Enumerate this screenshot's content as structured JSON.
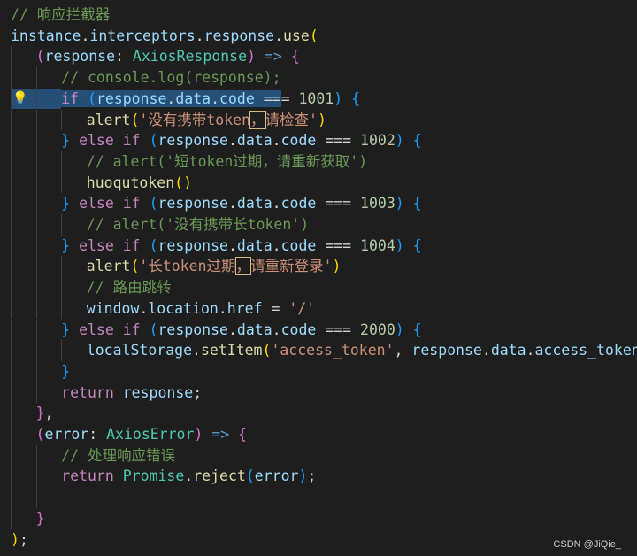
{
  "editor": {
    "lines": [
      {
        "segments": [
          {
            "t": "// 响应拦截器",
            "c": "comment"
          }
        ]
      },
      {
        "segments": [
          {
            "t": "instance",
            "c": "variable"
          },
          {
            "t": ".",
            "c": "plain"
          },
          {
            "t": "interceptors",
            "c": "variable"
          },
          {
            "t": ".",
            "c": "plain"
          },
          {
            "t": "response",
            "c": "variable"
          },
          {
            "t": ".",
            "c": "plain"
          },
          {
            "t": "use",
            "c": "function"
          },
          {
            "t": "(",
            "c": "brace1"
          }
        ]
      },
      {
        "segments": [
          {
            "t": "(",
            "c": "brace2"
          },
          {
            "t": "response",
            "c": "variable"
          },
          {
            "t": ": ",
            "c": "plain"
          },
          {
            "t": "AxiosResponse",
            "c": "type"
          },
          {
            "t": ")",
            "c": "brace2"
          },
          {
            "t": " ",
            "c": "plain"
          },
          {
            "t": "=>",
            "c": "storage"
          },
          {
            "t": " ",
            "c": "plain"
          },
          {
            "t": "{",
            "c": "brace2"
          }
        ]
      },
      {
        "segments": [
          {
            "t": "// console.log(response);",
            "c": "comment"
          }
        ]
      },
      {
        "segments": [
          {
            "t": "if",
            "c": "keyword",
            "sel": true
          },
          {
            "t": " ",
            "c": "plain",
            "sel": true
          },
          {
            "t": "(",
            "c": "brace3",
            "sel": true
          },
          {
            "t": "response",
            "c": "variable",
            "sel": true
          },
          {
            "t": ".",
            "c": "plain",
            "sel": true
          },
          {
            "t": "data",
            "c": "variable",
            "sel": true
          },
          {
            "t": ".",
            "c": "plain",
            "sel": true
          },
          {
            "t": "code",
            "c": "variable",
            "sel": true
          },
          {
            "t": " ==",
            "c": "plain",
            "sel": true
          },
          {
            "t": "=",
            "c": "plain"
          },
          {
            "t": " ",
            "c": "plain"
          },
          {
            "t": "1001",
            "c": "number"
          },
          {
            "t": ")",
            "c": "brace3"
          },
          {
            "t": " ",
            "c": "plain"
          },
          {
            "t": "{",
            "c": "brace3"
          }
        ]
      },
      {
        "segments": [
          {
            "t": "alert",
            "c": "function"
          },
          {
            "t": "(",
            "c": "brace1"
          },
          {
            "t": "'没有携带token",
            "c": "string"
          },
          {
            "t": "，",
            "c": "string",
            "box": true
          },
          {
            "t": "请检查'",
            "c": "string"
          },
          {
            "t": ")",
            "c": "brace1"
          }
        ]
      },
      {
        "segments": [
          {
            "t": "}",
            "c": "brace3"
          },
          {
            "t": " ",
            "c": "plain"
          },
          {
            "t": "else",
            "c": "keyword"
          },
          {
            "t": " ",
            "c": "plain"
          },
          {
            "t": "if",
            "c": "keyword"
          },
          {
            "t": " ",
            "c": "plain"
          },
          {
            "t": "(",
            "c": "brace3"
          },
          {
            "t": "response",
            "c": "variable"
          },
          {
            "t": ".",
            "c": "plain"
          },
          {
            "t": "data",
            "c": "variable"
          },
          {
            "t": ".",
            "c": "plain"
          },
          {
            "t": "code",
            "c": "variable"
          },
          {
            "t": " === ",
            "c": "plain"
          },
          {
            "t": "1002",
            "c": "number"
          },
          {
            "t": ")",
            "c": "brace3"
          },
          {
            "t": " ",
            "c": "plain"
          },
          {
            "t": "{",
            "c": "brace3"
          }
        ]
      },
      {
        "segments": [
          {
            "t": "// alert('短token过期，请重新获取')",
            "c": "comment"
          }
        ]
      },
      {
        "segments": [
          {
            "t": "huoqutoken",
            "c": "function"
          },
          {
            "t": "()",
            "c": "brace1"
          }
        ]
      },
      {
        "segments": [
          {
            "t": "}",
            "c": "brace3"
          },
          {
            "t": " ",
            "c": "plain"
          },
          {
            "t": "else",
            "c": "keyword"
          },
          {
            "t": " ",
            "c": "plain"
          },
          {
            "t": "if",
            "c": "keyword"
          },
          {
            "t": " ",
            "c": "plain"
          },
          {
            "t": "(",
            "c": "brace3"
          },
          {
            "t": "response",
            "c": "variable"
          },
          {
            "t": ".",
            "c": "plain"
          },
          {
            "t": "data",
            "c": "variable"
          },
          {
            "t": ".",
            "c": "plain"
          },
          {
            "t": "code",
            "c": "variable"
          },
          {
            "t": " === ",
            "c": "plain"
          },
          {
            "t": "1003",
            "c": "number"
          },
          {
            "t": ")",
            "c": "brace3"
          },
          {
            "t": " ",
            "c": "plain"
          },
          {
            "t": "{",
            "c": "brace3"
          }
        ]
      },
      {
        "segments": [
          {
            "t": "// alert('没有携带长token')",
            "c": "comment"
          }
        ]
      },
      {
        "segments": [
          {
            "t": "}",
            "c": "brace3"
          },
          {
            "t": " ",
            "c": "plain"
          },
          {
            "t": "else",
            "c": "keyword"
          },
          {
            "t": " ",
            "c": "plain"
          },
          {
            "t": "if",
            "c": "keyword"
          },
          {
            "t": " ",
            "c": "plain"
          },
          {
            "t": "(",
            "c": "brace3"
          },
          {
            "t": "response",
            "c": "variable"
          },
          {
            "t": ".",
            "c": "plain"
          },
          {
            "t": "data",
            "c": "variable"
          },
          {
            "t": ".",
            "c": "plain"
          },
          {
            "t": "code",
            "c": "variable"
          },
          {
            "t": " === ",
            "c": "plain"
          },
          {
            "t": "1004",
            "c": "number"
          },
          {
            "t": ")",
            "c": "brace3"
          },
          {
            "t": " ",
            "c": "plain"
          },
          {
            "t": "{",
            "c": "brace3"
          }
        ]
      },
      {
        "segments": [
          {
            "t": "alert",
            "c": "function"
          },
          {
            "t": "(",
            "c": "brace1"
          },
          {
            "t": "'长token过期",
            "c": "string"
          },
          {
            "t": "，",
            "c": "string",
            "box": true
          },
          {
            "t": "请重新登录'",
            "c": "string"
          },
          {
            "t": ")",
            "c": "brace1"
          }
        ]
      },
      {
        "segments": [
          {
            "t": "// 路由跳转",
            "c": "comment"
          }
        ]
      },
      {
        "segments": [
          {
            "t": "window",
            "c": "variable"
          },
          {
            "t": ".",
            "c": "plain"
          },
          {
            "t": "location",
            "c": "variable"
          },
          {
            "t": ".",
            "c": "plain"
          },
          {
            "t": "href",
            "c": "variable"
          },
          {
            "t": " = ",
            "c": "plain"
          },
          {
            "t": "'/'",
            "c": "string"
          }
        ]
      },
      {
        "segments": [
          {
            "t": "}",
            "c": "brace3"
          },
          {
            "t": " ",
            "c": "plain"
          },
          {
            "t": "else",
            "c": "keyword"
          },
          {
            "t": " ",
            "c": "plain"
          },
          {
            "t": "if",
            "c": "keyword"
          },
          {
            "t": " ",
            "c": "plain"
          },
          {
            "t": "(",
            "c": "brace3"
          },
          {
            "t": "response",
            "c": "variable"
          },
          {
            "t": ".",
            "c": "plain"
          },
          {
            "t": "data",
            "c": "variable"
          },
          {
            "t": ".",
            "c": "plain"
          },
          {
            "t": "code",
            "c": "variable"
          },
          {
            "t": " === ",
            "c": "plain"
          },
          {
            "t": "2000",
            "c": "number"
          },
          {
            "t": ")",
            "c": "brace3"
          },
          {
            "t": " ",
            "c": "plain"
          },
          {
            "t": "{",
            "c": "brace3"
          }
        ]
      },
      {
        "segments": [
          {
            "t": "localStorage",
            "c": "variable"
          },
          {
            "t": ".",
            "c": "plain"
          },
          {
            "t": "setItem",
            "c": "function"
          },
          {
            "t": "(",
            "c": "brace1"
          },
          {
            "t": "'access_token'",
            "c": "string"
          },
          {
            "t": ", ",
            "c": "plain"
          },
          {
            "t": "response",
            "c": "variable"
          },
          {
            "t": ".",
            "c": "plain"
          },
          {
            "t": "data",
            "c": "variable"
          },
          {
            "t": ".",
            "c": "plain"
          },
          {
            "t": "access_token",
            "c": "variable"
          },
          {
            "t": ")",
            "c": "brace1"
          }
        ]
      },
      {
        "segments": [
          {
            "t": "}",
            "c": "brace3"
          }
        ]
      },
      {
        "segments": [
          {
            "t": "return",
            "c": "keyword"
          },
          {
            "t": " ",
            "c": "plain"
          },
          {
            "t": "response",
            "c": "variable"
          },
          {
            "t": ";",
            "c": "plain"
          }
        ]
      },
      {
        "segments": [
          {
            "t": "}",
            "c": "brace2"
          },
          {
            "t": ",",
            "c": "plain"
          }
        ]
      },
      {
        "segments": [
          {
            "t": "(",
            "c": "brace2"
          },
          {
            "t": "error",
            "c": "variable"
          },
          {
            "t": ": ",
            "c": "plain"
          },
          {
            "t": "AxiosError",
            "c": "type"
          },
          {
            "t": ")",
            "c": "brace2"
          },
          {
            "t": " ",
            "c": "plain"
          },
          {
            "t": "=>",
            "c": "storage"
          },
          {
            "t": " ",
            "c": "plain"
          },
          {
            "t": "{",
            "c": "brace2"
          }
        ]
      },
      {
        "segments": [
          {
            "t": "// 处理响应错误",
            "c": "comment"
          }
        ]
      },
      {
        "segments": [
          {
            "t": "return",
            "c": "keyword"
          },
          {
            "t": " ",
            "c": "plain"
          },
          {
            "t": "Promise",
            "c": "type"
          },
          {
            "t": ".",
            "c": "plain"
          },
          {
            "t": "reject",
            "c": "function"
          },
          {
            "t": "(",
            "c": "brace3"
          },
          {
            "t": "error",
            "c": "variable"
          },
          {
            "t": ")",
            "c": "brace3"
          },
          {
            "t": ";",
            "c": "plain"
          }
        ]
      },
      {
        "segments": []
      },
      {
        "segments": [
          {
            "t": "}",
            "c": "brace2"
          }
        ]
      },
      {
        "segments": [
          {
            "t": ")",
            "c": "brace1"
          },
          {
            "t": ";",
            "c": "plain"
          }
        ]
      }
    ]
  },
  "lightbulb_icon": "lightbulb-icon",
  "watermark": "CSDN @JiQie_",
  "colors": {
    "background": "#1e1e1e",
    "comment": "#6a9955",
    "keyword": "#c586c0",
    "variable": "#9cdcfe",
    "function": "#dcdcaa",
    "type": "#4ec9b0",
    "string": "#ce9178",
    "number": "#b5cea8",
    "selection": "#264f78"
  }
}
